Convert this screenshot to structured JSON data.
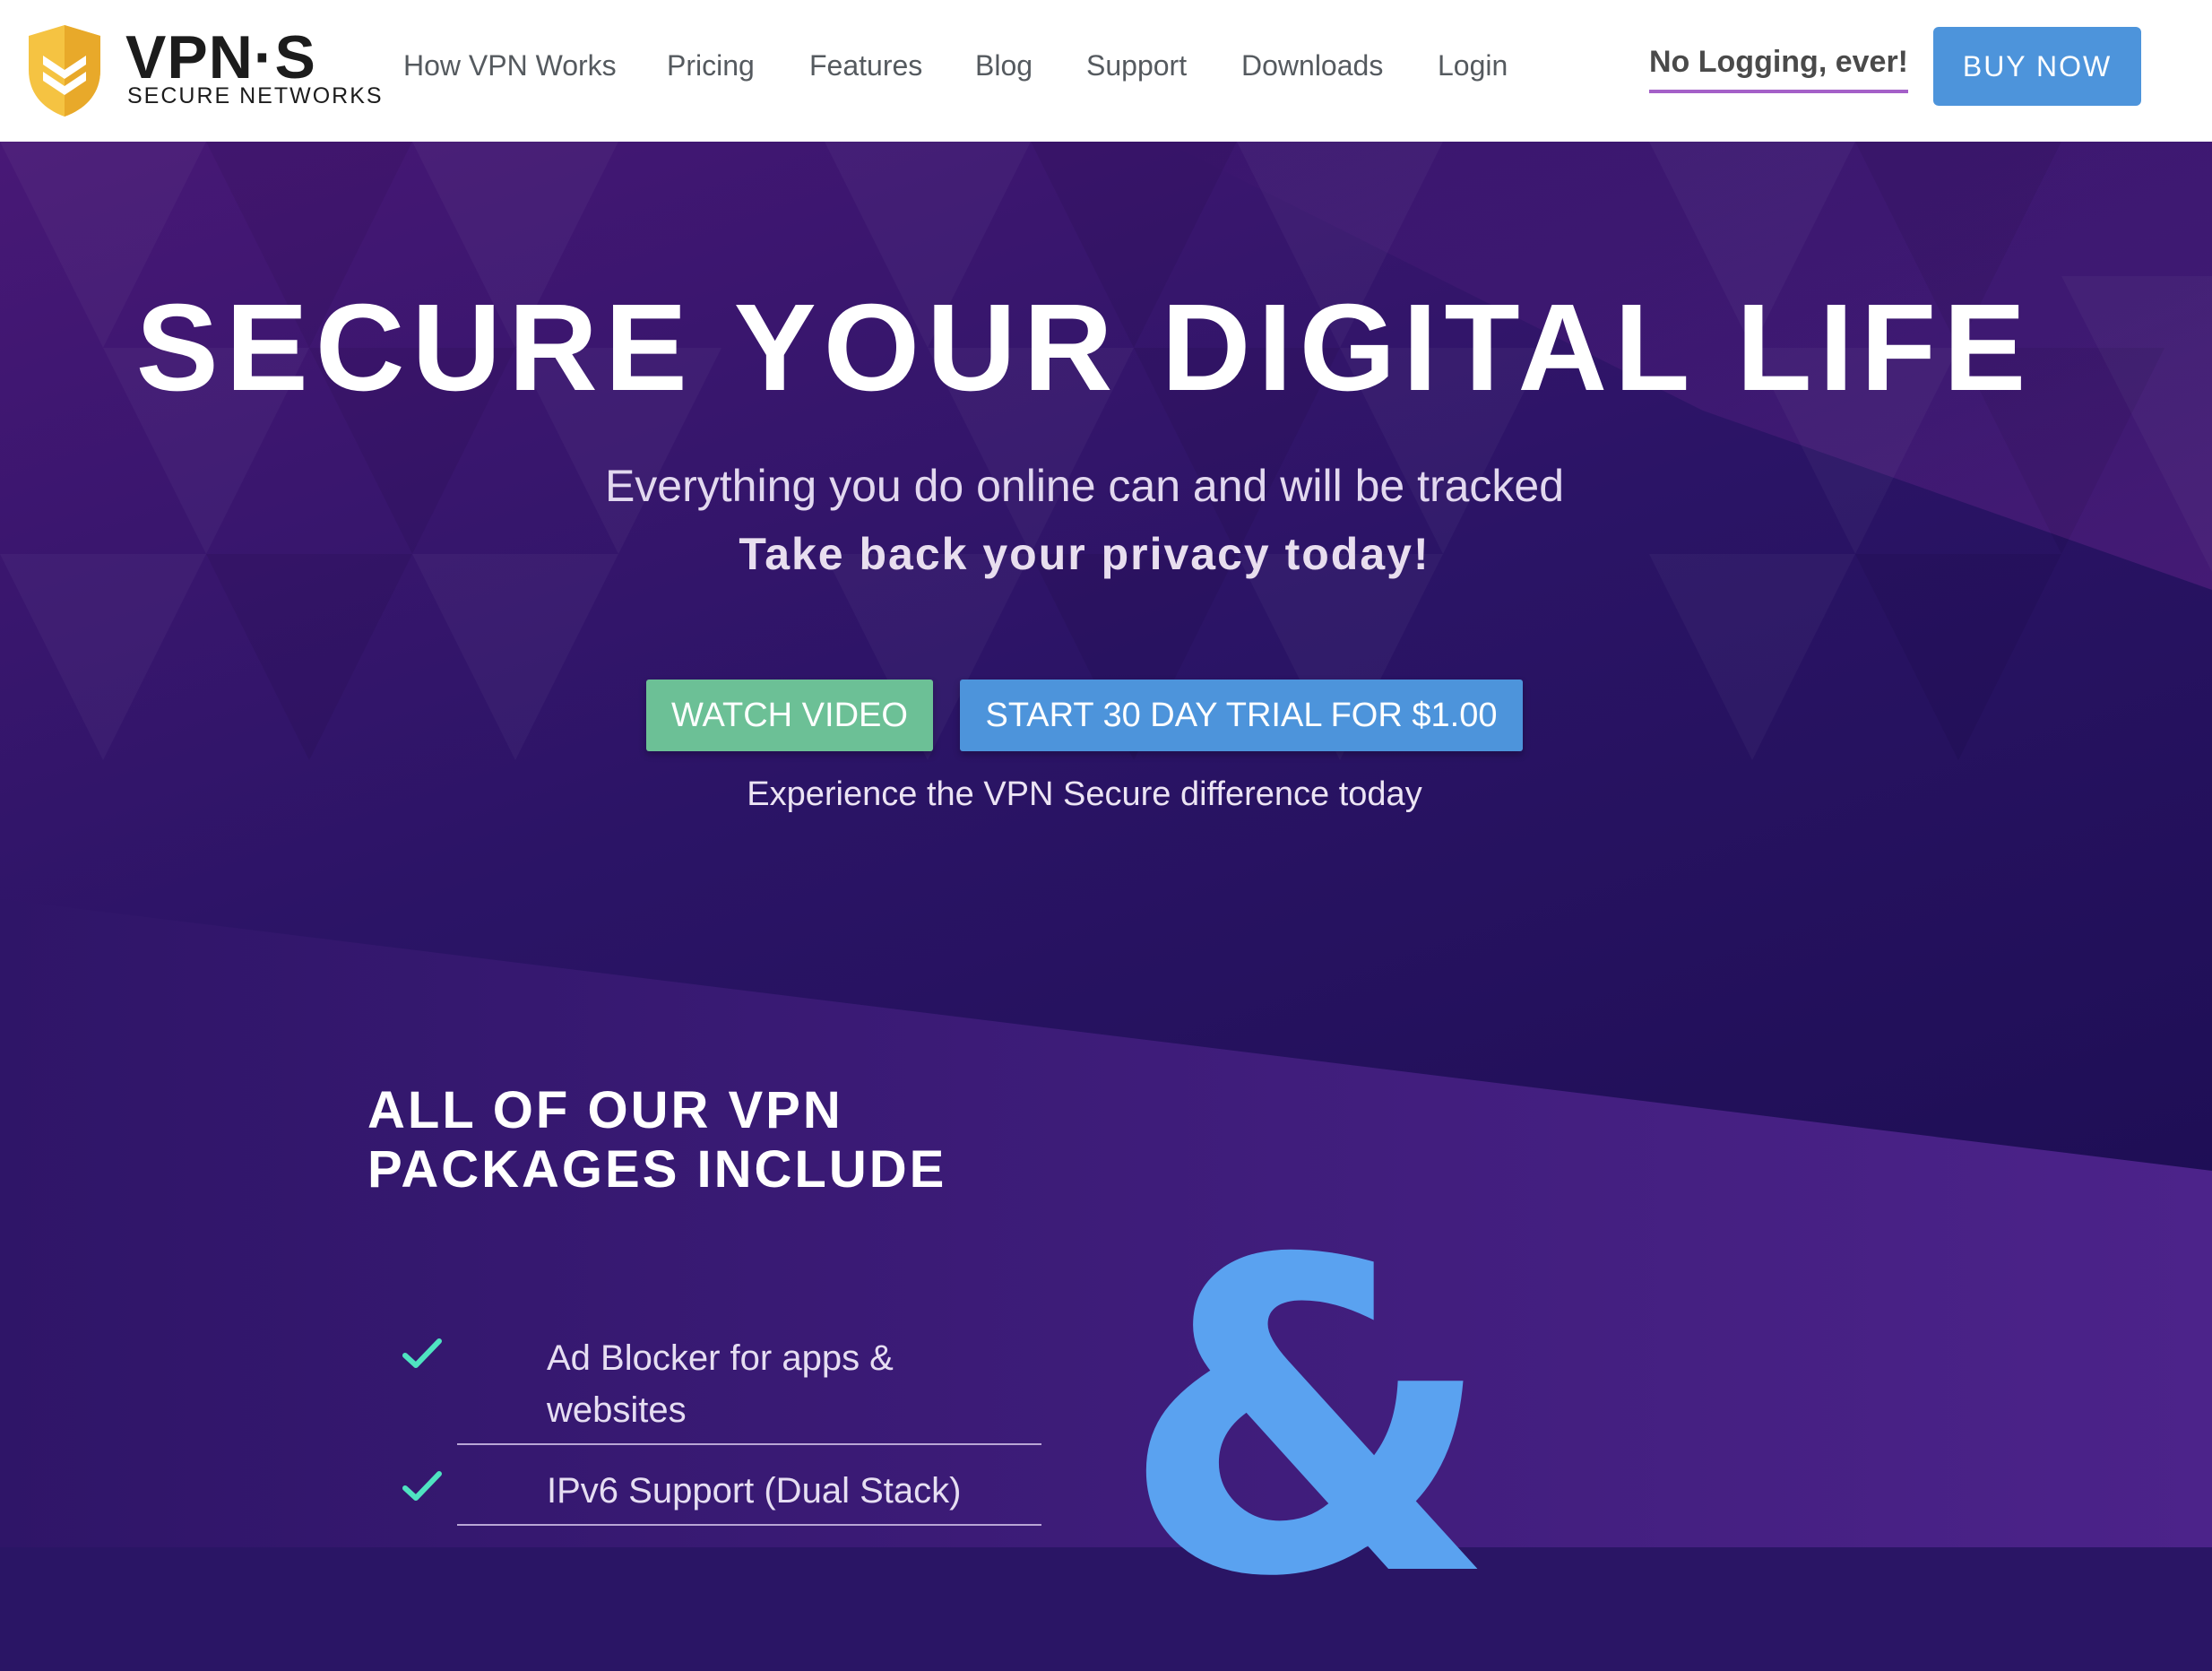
{
  "brand": {
    "name": "VPN·S",
    "tagline": "SECURE NETWORKS",
    "shield_color": "#f5c342",
    "logo_icon": "shield-chevron-icon"
  },
  "nav": {
    "items": [
      {
        "label": "How VPN Works"
      },
      {
        "label": "Pricing"
      },
      {
        "label": "Features"
      },
      {
        "label": "Blog"
      },
      {
        "label": "Support"
      },
      {
        "label": "Downloads"
      },
      {
        "label": "Login"
      }
    ],
    "no_logging": "No Logging, ever!",
    "buy_now": "BUY NOW"
  },
  "hero": {
    "title": "SECURE YOUR DIGITAL LIFE",
    "subtitle": "Everything you do online can and will be tracked",
    "subtitle_bold": "Take back your privacy today!",
    "watch_video": "WATCH VIDEO",
    "trial": "START 30 DAY TRIAL FOR $1.00",
    "note": "Experience the VPN Secure difference today"
  },
  "packages": {
    "title_line1": "ALL OF OUR VPN",
    "title_line2": "PACKAGES INCLUDE",
    "features": [
      {
        "label": "Ad Blocker for apps & websites",
        "icon": "checkmark-icon"
      },
      {
        "label": "IPv6 Support (Dual Stack)",
        "icon": "checkmark-icon"
      }
    ],
    "ampersand": "&"
  },
  "colors": {
    "primary_blue": "#4d94db",
    "video_green": "#6cc096",
    "check_teal": "#4fe3c1",
    "hero_purple": "#3d1a72",
    "underline_purple": "#a460c8"
  }
}
